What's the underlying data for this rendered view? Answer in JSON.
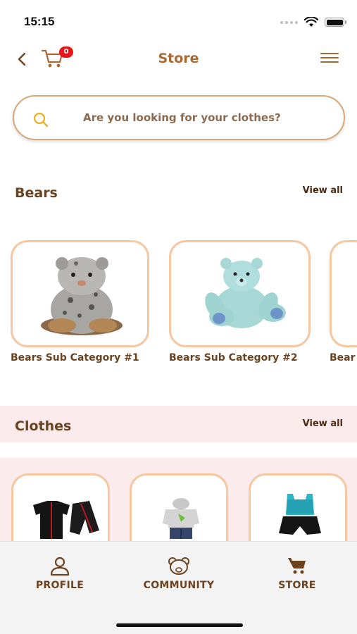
{
  "status": {
    "time": "15:15"
  },
  "header": {
    "title": "Store",
    "cart_count": "0"
  },
  "search": {
    "placeholder": "Are you looking for your clothes?"
  },
  "sections": {
    "bears": {
      "title": "Bears",
      "view_all": "View all",
      "items": [
        {
          "label": "Bears Sub Category #1",
          "image": "snow-leopard-plush"
        },
        {
          "label": "Bears Sub Category #2",
          "image": "mint-teddy-bear"
        },
        {
          "label": "Bear",
          "image": "bear-plush-partial"
        }
      ]
    },
    "clothes": {
      "title": "Clothes",
      "view_all": "View all",
      "items": [
        {
          "image": "black-red-outfit"
        },
        {
          "image": "grey-hoodie-jeans"
        },
        {
          "image": "teal-tank-black-shorts"
        }
      ]
    }
  },
  "bottom_nav": {
    "items": [
      {
        "label": "PROFILE",
        "icon": "person-icon"
      },
      {
        "label": "COMMUNITY",
        "icon": "bear-head-icon"
      },
      {
        "label": "STORE",
        "icon": "cart-icon"
      }
    ]
  },
  "colors": {
    "accent": "#a86a35",
    "text_brown": "#6b4320",
    "card_border": "#f6c7a1",
    "pink_band": "#fcebec",
    "badge_red": "#e8161b"
  }
}
